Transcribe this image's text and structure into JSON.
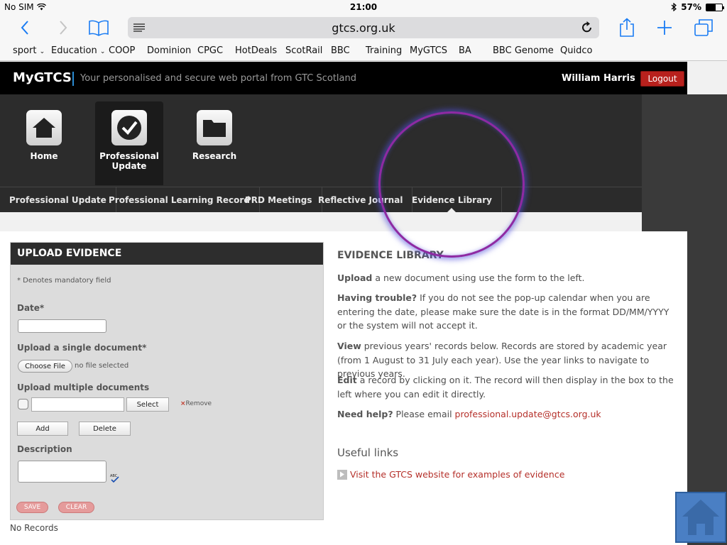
{
  "status_bar": {
    "carrier": "No SIM",
    "time": "21:00",
    "battery": "57%",
    "battery_level": 0.57
  },
  "browser": {
    "url": "gtcs.org.uk",
    "bookmarks": [
      "sport",
      "Education",
      "COOP",
      "Dominion",
      "CPGC",
      "HotDeals",
      "ScotRail",
      "BBC",
      "Training",
      "MyGTCS",
      "BA",
      "BBC Genome",
      "Quidco"
    ]
  },
  "header": {
    "brand": "MyGTCS",
    "tagline": "Your personalised and secure web portal from GTC Scotland",
    "user": "William Harris",
    "logout": "Logout"
  },
  "main_nav": [
    {
      "label": "Home"
    },
    {
      "label": "Professional",
      "label2": "Update"
    },
    {
      "label": "Research"
    }
  ],
  "sub_nav": [
    "Professional Update",
    "Professional Learning Record",
    "PRD Meetings",
    "Reflective Journal",
    "Evidence Library"
  ],
  "upload": {
    "title": "UPLOAD EVIDENCE",
    "mandatory_note": "* Denotes mandatory field",
    "date_label": "Date*",
    "single_label": "Upload a single document*",
    "choose_file": "Choose File",
    "no_file": "no file selected",
    "multiple_label": "Upload multiple documents",
    "select": "Select",
    "remove": "Remove",
    "add": "Add",
    "delete": "Delete",
    "description_label": "Description",
    "save": "SAVE",
    "clear": "CLEAR"
  },
  "no_records": "No Records",
  "library": {
    "heading": "EVIDENCE LIBRARY",
    "p1_bold": "Upload",
    "p1": " a new document using use the form to the left.",
    "p2_bold": "Having trouble?",
    "p2": " If you do not see the pop-up calendar when you are entering the date, please make sure the date is in the format DD/MM/YYYY or the system will not accept it.",
    "p3_bold": "View",
    "p3": " previous years' records below. Records are stored by academic year (from 1 August to 31 July each year). Use the year links to navigate to previous years.",
    "p4_bold": "Edit",
    "p4": " a record by clicking on it. The record will then display in the box to the left where you can edit it directly.",
    "p5_bold": "Need help?",
    "p5": " Please email ",
    "p5_link": "professional.update@gtcs.org.uk",
    "useful_heading": "Useful links",
    "visit_link": "Visit the GTCS website for examples of evidence"
  }
}
